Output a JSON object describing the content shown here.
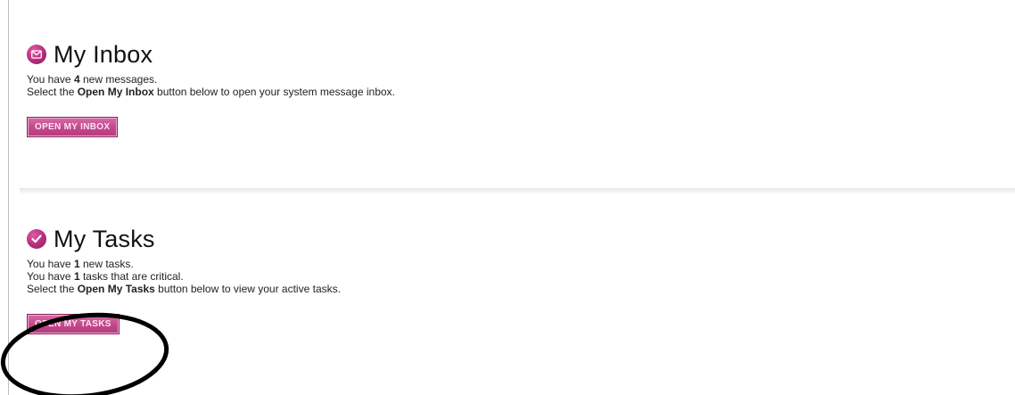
{
  "inbox": {
    "title": "My Inbox",
    "icon": "envelope-icon",
    "line1_prefix": "You have ",
    "count": "4",
    "line1_suffix": " new messages.",
    "line2_prefix": "Select the ",
    "button_ref": "Open My Inbox",
    "line2_suffix": " button below to open your system message inbox.",
    "button_label": "OPEN MY INBOX"
  },
  "tasks": {
    "title": "My Tasks",
    "icon": "checkmark-icon",
    "line1_prefix": "You have ",
    "new_count": "1",
    "line1_suffix": " new tasks.",
    "line2_prefix": "You have ",
    "critical_count": "1",
    "line2_suffix": " tasks that are critical.",
    "line3_prefix": "Select the ",
    "button_ref": "Open My Tasks",
    "line3_suffix": " button below to view your active tasks.",
    "button_label": "OPEN MY TASKS"
  },
  "colors": {
    "accent": "#c44a8c",
    "accent_dark": "#8d1c5d",
    "annotation": "#000000"
  }
}
